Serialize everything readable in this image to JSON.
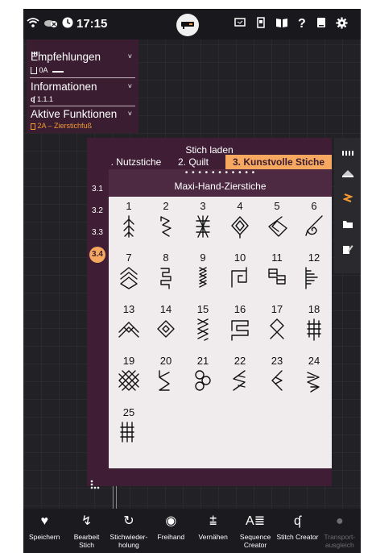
{
  "statusbar": {
    "time": "17:15",
    "icons": [
      "wifi-icon",
      "cloud-off-icon",
      "clock-icon",
      "machine-logo-icon",
      "screen-icon",
      "usb-icon",
      "book-icon",
      "help-icon",
      "manual-icon",
      "settings-icon"
    ]
  },
  "info_panel": {
    "header_icon": "bars-icon",
    "empfehlungen": {
      "label": "Empfehlungen",
      "value": "0A"
    },
    "informationen": {
      "label": "Informationen",
      "value": "1.1.1"
    },
    "aktive": {
      "label": "Aktive Funktionen",
      "value": "2A – Zierstichfuß"
    }
  },
  "dialog": {
    "title": "Stich laden",
    "tabs": [
      {
        "label": ". Nutzstiche"
      },
      {
        "label": "2. Quilt"
      },
      {
        "label": "3. Kunstvolle Stiche",
        "active": true
      }
    ],
    "sub_dots": "• • • • • • • • • • •",
    "sub_name": "Maxi-Hand-Zierstiche",
    "categories": [
      "3.1",
      "3.2",
      "3.3",
      "3.4"
    ],
    "active_category": "3.4",
    "stitches": [
      {
        "num": "1"
      },
      {
        "num": "2"
      },
      {
        "num": "3"
      },
      {
        "num": "4"
      },
      {
        "num": "5"
      },
      {
        "num": "6"
      },
      {
        "num": "7"
      },
      {
        "num": "8"
      },
      {
        "num": "9"
      },
      {
        "num": "10"
      },
      {
        "num": "11"
      },
      {
        "num": "12"
      },
      {
        "num": "13"
      },
      {
        "num": "14"
      },
      {
        "num": "15"
      },
      {
        "num": "16"
      },
      {
        "num": "17"
      },
      {
        "num": "18"
      },
      {
        "num": "19"
      },
      {
        "num": "20"
      },
      {
        "num": "21"
      },
      {
        "num": "22"
      },
      {
        "num": "23"
      },
      {
        "num": "24"
      },
      {
        "num": "25"
      }
    ]
  },
  "rightbar": {
    "icons": [
      "menu-dots-icon",
      "presser-foot-icon",
      "stitch-icon",
      "folder-icon",
      "edit-icon"
    ]
  },
  "toolbar": {
    "items": [
      {
        "label": "Speichern",
        "icon": "heart-icon"
      },
      {
        "label": "Bearbeit Stich",
        "icon": "edit-stitch-icon"
      },
      {
        "label": "Stichwieder- holung",
        "icon": "repeat-icon"
      },
      {
        "label": "Freihand",
        "icon": "freehand-icon"
      },
      {
        "label": "Vernähen",
        "icon": "tie-off-icon"
      },
      {
        "label": "Sequence Creator",
        "icon": "sequence-icon"
      },
      {
        "label": "Stitch Creator",
        "icon": "stitch-creator-icon"
      },
      {
        "label": "Transport- ausgleich",
        "icon": "transport-icon",
        "disabled": true
      }
    ]
  },
  "colors": {
    "accent": "#f7a860",
    "panel": "#3a1d31",
    "dialog": "#3f1e35",
    "stitch_bg": "#f0ecee",
    "bg": "#222126"
  }
}
